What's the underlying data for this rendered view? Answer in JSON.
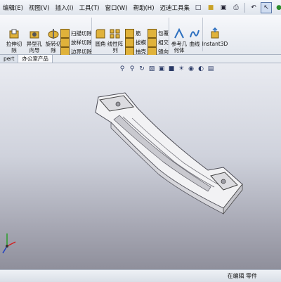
{
  "menubar": {
    "items": [
      "编辑(E)",
      "视图(V)",
      "插入(I)",
      "工具(T)",
      "窗口(W)",
      "帮助(H)",
      "迈迪工具集"
    ]
  },
  "ribbon": {
    "extrude_cut": "拉伸切\n除",
    "hole_wizard": "异型孔\n向导",
    "revolve_cut": "旋转切\n除",
    "swept_cut": "扫描切除",
    "loft_cut": "放样切除",
    "boundary_cut": "边界切除",
    "fillet": "圆角",
    "linear_pattern": "线性阵\n列",
    "rib": "筋",
    "draft": "拔模",
    "shell": "抽壳",
    "wrap": "包覆",
    "intersect": "相交",
    "mirror": "镜向",
    "reference_geometry": "参考几\n何体",
    "curves": "曲线",
    "instant3d": "Instant3D"
  },
  "tabs": [
    "pert",
    "办公室产品"
  ],
  "status": {
    "text": "在编辑 零件"
  },
  "colors": {
    "viewport_top": "#e9ebf1",
    "viewport_bottom": "#8f8f9b",
    "part": "#f2f2f4"
  }
}
